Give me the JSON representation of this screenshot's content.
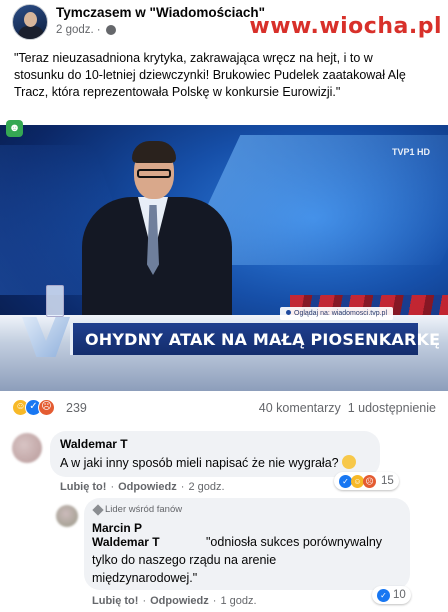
{
  "watermark": "www.wiocha.pl",
  "post": {
    "page_name": "Tymczasem w \"Wiadomościach\"",
    "time": "2 godz.",
    "separator": "·",
    "text": "\"Teraz nieuzasadniona krytyka, zakrawająca wręcz na hejt, i to w stosunku do 10-letniej dziewczynki! Brukowiec Pudelek zaatakował Alę Tracz, która reprezentowała Polskę w konkursie Eurowizji.\""
  },
  "video": {
    "corner_logo": "TVP1 HD",
    "source_label": "Oglądaj na: wiadomosci.tvp.pl",
    "chyron": "OHYDNY ATAK NA MAŁĄ PIOSENKARKĘ"
  },
  "stats": {
    "reactions": "239",
    "comments": "40 komentarzy",
    "shares": "1 udostępnienie"
  },
  "comment1": {
    "author": "Waldemar T",
    "text": "A w jaki inny sposób mieli napisać że nie wygrała?",
    "reactions": "15",
    "like": "Lubię to!",
    "reply": "Odpowiedz",
    "time": "2 godz."
  },
  "comment2": {
    "badge": "Lider wśród fanów",
    "author": "Marcin P",
    "tag": "Waldemar T",
    "line1": "\"odniosła sukces porównywalny",
    "line2": "tylko do naszego rządu na arenie",
    "line3": "międzynarodowej.\"",
    "reactions": "10",
    "like": "Lubię to!",
    "reply": "Odpowiedz",
    "time": "1 godz."
  },
  "icons": {
    "reaction_haha": "haha-icon",
    "reaction_like": "like-icon",
    "reaction_angry": "angry-icon",
    "globe": "globe-icon",
    "diamond": "diamond-icon"
  },
  "colors": {
    "watermark": "#d8302a",
    "like_blue": "#1877f2",
    "chyron_bg": "#1f3f8f",
    "bubble_bg": "#f0f2f5",
    "meta_gray": "#65676b"
  }
}
